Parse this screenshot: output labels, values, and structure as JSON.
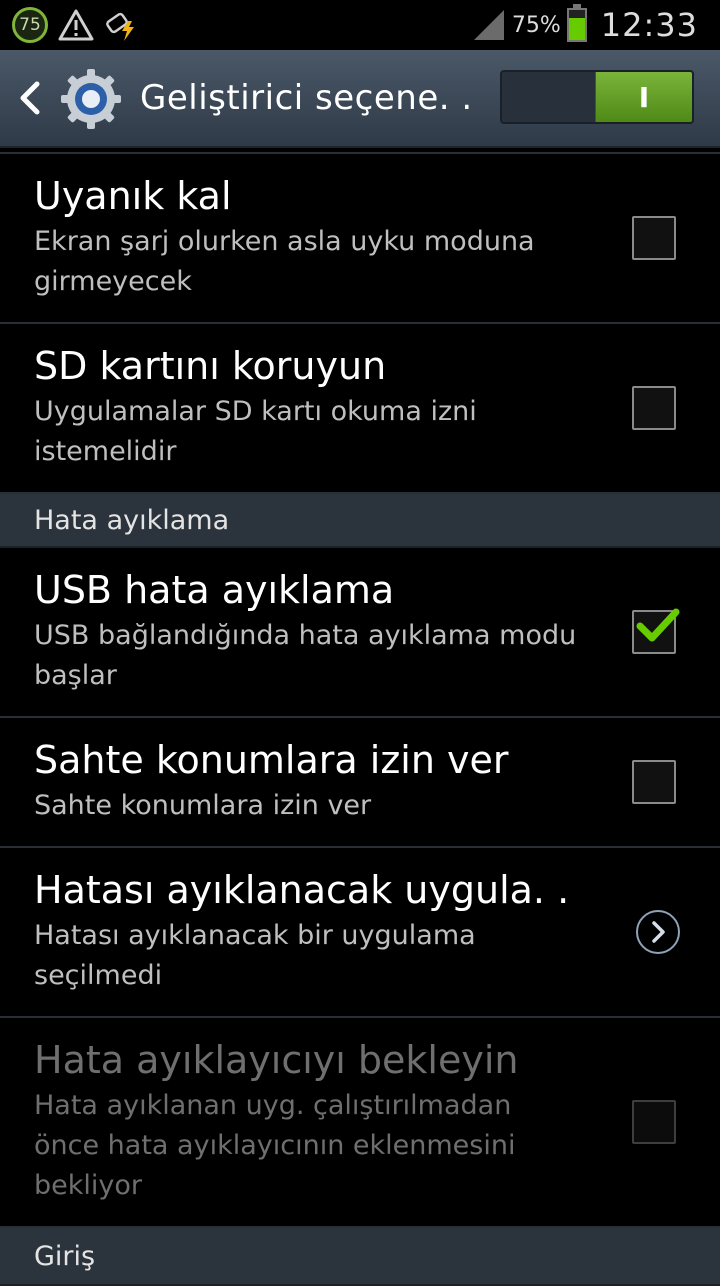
{
  "status_bar": {
    "badge": "75",
    "battery_percent": "75%",
    "battery_level": 0.75,
    "time": "12:33",
    "icons": [
      "data-75-badge-icon",
      "warning-icon",
      "usb-charging-icon",
      "signal-icon",
      "battery-icon"
    ]
  },
  "action_bar": {
    "title": "Geliştirici seçene. .",
    "toggle_label": "I",
    "toggle_on": true,
    "icons": [
      "back-icon",
      "settings-gear-icon"
    ]
  },
  "items": [
    {
      "title": "Uyanık kal",
      "subtitle": "Ekran şarj olurken asla uyku moduna girmeyecek",
      "control": "checkbox",
      "checked": false
    },
    {
      "title": "SD kartını koruyun",
      "subtitle": "Uygulamalar SD kartı okuma izni istemelidir",
      "control": "checkbox",
      "checked": false
    }
  ],
  "section_debug": "Hata ayıklama",
  "debug_items": [
    {
      "title": "USB hata ayıklama",
      "subtitle": "USB bağlandığında hata ayıklama modu başlar",
      "control": "checkbox",
      "checked": true
    },
    {
      "title": "Sahte konumlara izin ver",
      "subtitle": "Sahte konumlara izin ver",
      "control": "checkbox",
      "checked": false
    },
    {
      "title": "Hatası ayıklanacak uygula. .",
      "subtitle": "Hatası ayıklanacak bir uygulama seçilmedi",
      "control": "chevron"
    },
    {
      "title": "Hata ayıklayıcıyı bekleyin",
      "subtitle": "Hata ayıklanan uyg. çalıştırılmadan önce hata ayıklayıcının eklenmesini bekliyor",
      "control": "checkbox",
      "checked": false,
      "disabled": true
    }
  ],
  "section_input": "Giriş",
  "colors": {
    "accent_green": "#66cc00",
    "action_bar": "#3d4957",
    "section_bg": "#2b333c"
  }
}
